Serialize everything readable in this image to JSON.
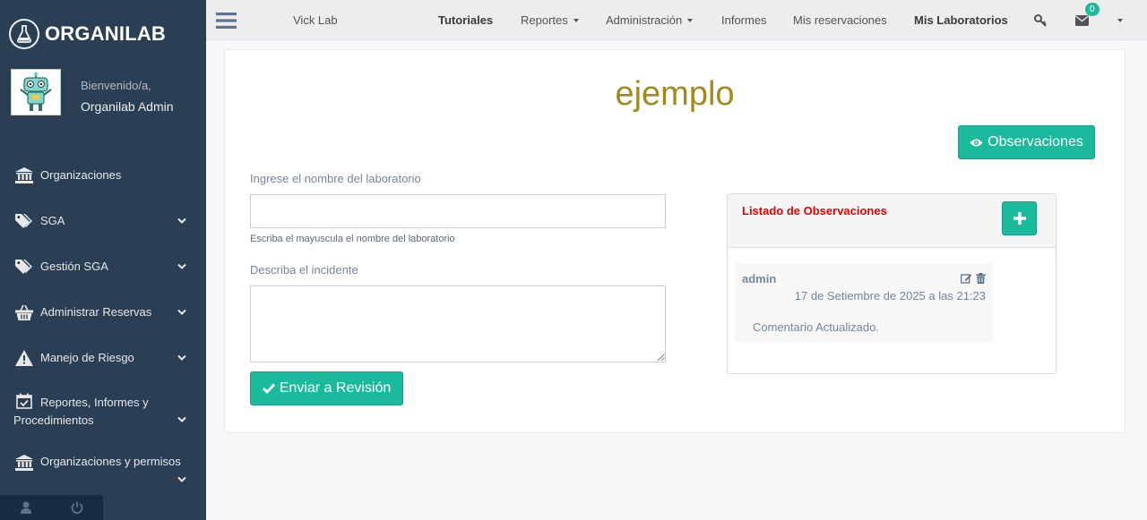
{
  "brand": {
    "name": "ORGANILAB",
    "logo_icon": "flask-icon"
  },
  "profile": {
    "welcome": "Bienvenido/a,",
    "name": "Organilab Admin"
  },
  "sidebar": {
    "items": [
      {
        "label": "Organizaciones",
        "icon": "institution-icon"
      },
      {
        "label": "SGA",
        "icon": "tags-icon"
      },
      {
        "label": "Gestión SGA",
        "icon": "tags-icon"
      },
      {
        "label": "Administrar Reservas",
        "icon": "basket-icon"
      },
      {
        "label": "Manejo de Riesgo",
        "icon": "warning-icon"
      },
      {
        "label": "Reportes, Informes y Procedimientos",
        "icon": "calendar-check-icon"
      },
      {
        "label": "Organizaciones y permisos",
        "icon": "institution-icon"
      }
    ]
  },
  "topnav": {
    "lab_name": "Vick Lab",
    "items": [
      "Tutoriales",
      "Reportes",
      "Administración",
      "Informes",
      "Mis reservaciones",
      "Mis Laboratorios"
    ],
    "mail_count": "0"
  },
  "page": {
    "title": "ejemplo",
    "observations_button": "Observaciones",
    "lab_name_label": "Ingrese el nombre del laboratorio",
    "lab_name_value": "",
    "lab_name_help": "Escriba el mayuscula el nombre del laboratorio",
    "incident_label": "Describa el incidente",
    "incident_value": "",
    "submit_button": "Enviar a Revisión"
  },
  "observations": {
    "title": "Listado de Observaciones",
    "comments": [
      {
        "author": "admin",
        "date": "17 de Setiembre de 2025 a las 21:23",
        "text": "Comentario Actualizado."
      }
    ]
  },
  "colors": {
    "sidebar": "#2a3f54",
    "accent": "#1abb9c",
    "title": "#a38a1a",
    "danger": "#e60000"
  }
}
